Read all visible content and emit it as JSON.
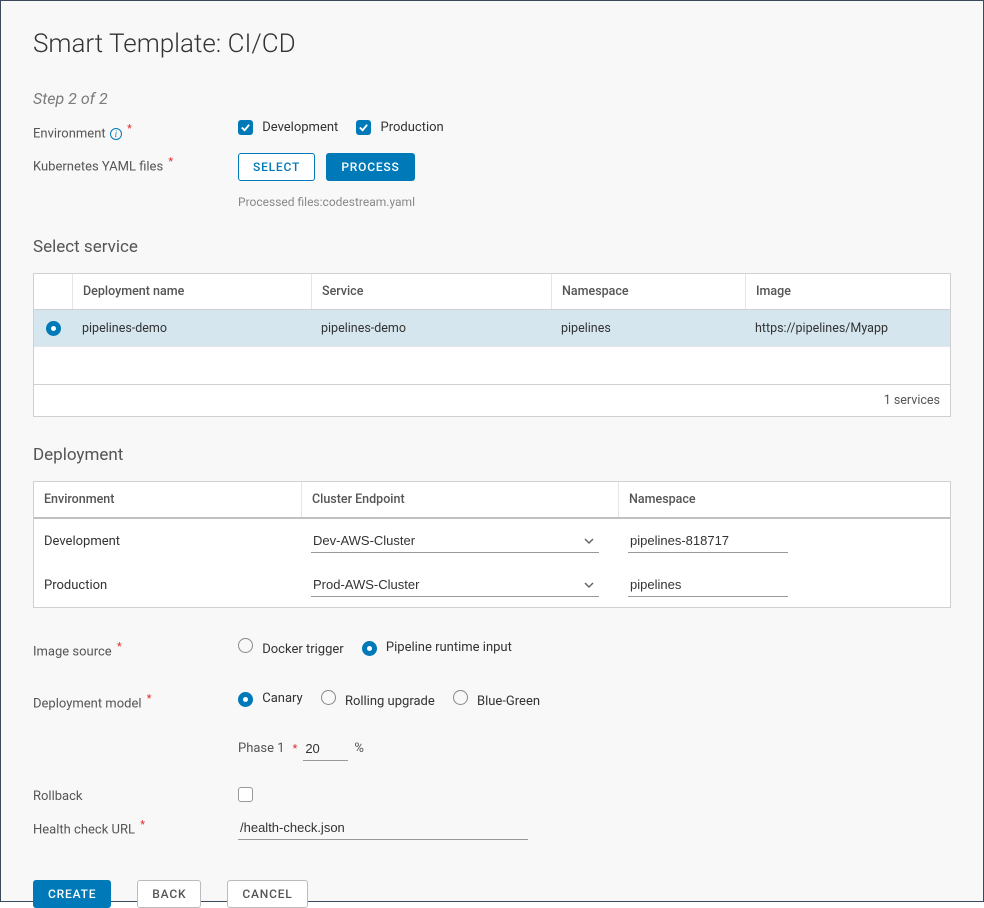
{
  "title": "Smart Template: CI/CD",
  "step": "Step 2 of 2",
  "labels": {
    "environment": "Environment",
    "k8s_files": "Kubernetes YAML files",
    "select_service": "Select service",
    "deployment": "Deployment",
    "image_source": "Image source",
    "deployment_model": "Deployment model",
    "rollback": "Rollback",
    "health_check": "Health check URL",
    "phase1": "Phase 1",
    "percent": "%"
  },
  "env_checkboxes": {
    "development": "Development",
    "production": "Production"
  },
  "buttons": {
    "select": "SELECT",
    "process": "PROCESS",
    "create": "CREATE",
    "back": "BACK",
    "cancel": "CANCEL"
  },
  "processed_note": "Processed files:codestream.yaml",
  "service_table": {
    "headers": {
      "deployment_name": "Deployment name",
      "service": "Service",
      "namespace": "Namespace",
      "image": "Image"
    },
    "row": {
      "deployment_name": "pipelines-demo",
      "service": "pipelines-demo",
      "namespace": "pipelines",
      "image": "https://pipelines/Myapp"
    },
    "count_label": "1 services"
  },
  "deployment_table": {
    "headers": {
      "environment": "Environment",
      "cluster_endpoint": "Cluster Endpoint",
      "namespace": "Namespace"
    },
    "rows": [
      {
        "environment": "Development",
        "endpoint": "Dev-AWS-Cluster",
        "namespace": "pipelines-818717"
      },
      {
        "environment": "Production",
        "endpoint": "Prod-AWS-Cluster",
        "namespace": "pipelines"
      }
    ]
  },
  "image_source_options": {
    "docker": "Docker trigger",
    "runtime": "Pipeline runtime input"
  },
  "deployment_model_options": {
    "canary": "Canary",
    "rolling": "Rolling upgrade",
    "bluegreen": "Blue-Green"
  },
  "phase1_value": "20",
  "health_check_value": "/health-check.json"
}
